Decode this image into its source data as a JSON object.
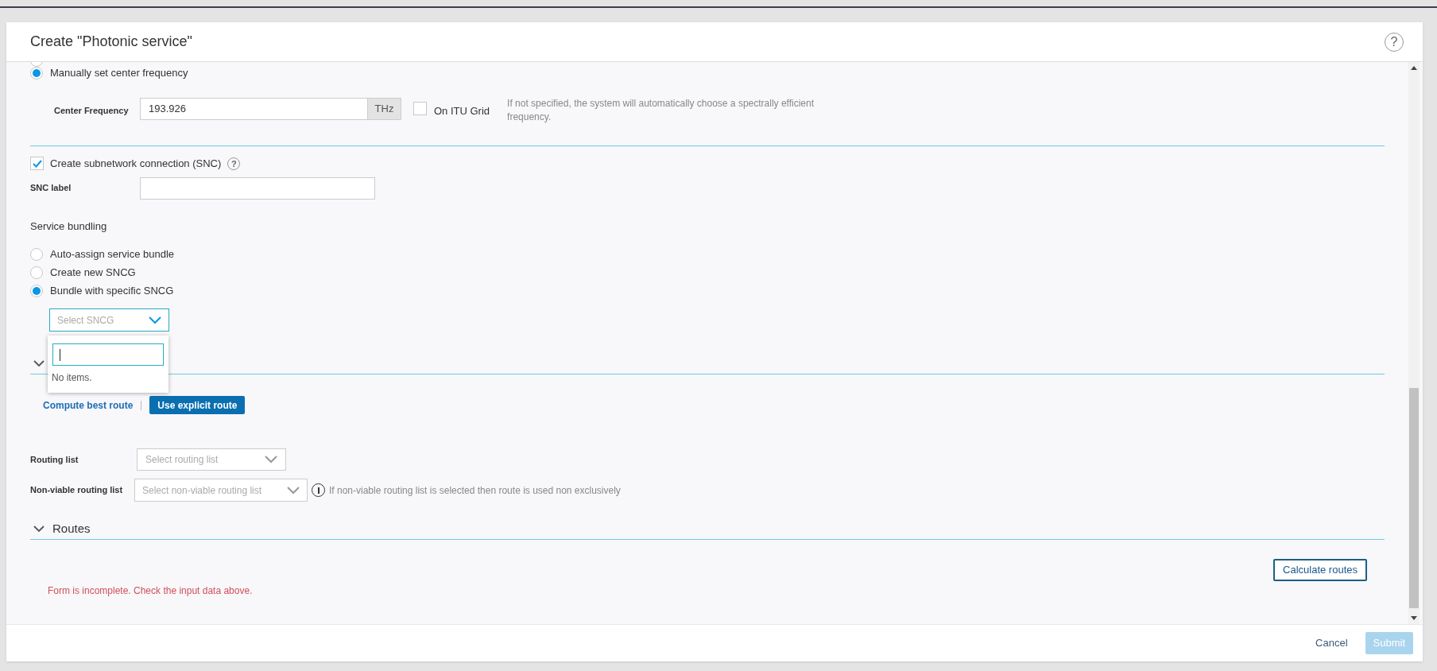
{
  "dialog": {
    "title": "Create \"Photonic service\"",
    "help": "?"
  },
  "frequency_mode": [
    {
      "selected": false
    },
    {
      "label": "Manually set center frequency",
      "selected": true
    }
  ],
  "center_frequency": {
    "label": "Center Frequency",
    "value": "193.926",
    "unit": "THz",
    "itu_grid": {
      "label": "On ITU Grid",
      "checked": false
    },
    "hint": "If not specified, the system will automatically choose a spectrally efficient frequency."
  },
  "snc": {
    "label": "Create subnetwork connection (SNC)",
    "checked": true,
    "help": "?"
  },
  "snc_label": {
    "label": "SNC label"
  },
  "service_bundling": {
    "title": "Service bundling",
    "options": [
      {
        "label": "Auto-assign service bundle",
        "selected": false
      },
      {
        "label": "Create new SNCG",
        "selected": false
      },
      {
        "label": "Bundle with specific SNCG",
        "selected": true
      }
    ],
    "sncg_select": {
      "placeholder": "Select SNCG",
      "open": true,
      "empty_text": "No items."
    }
  },
  "section_c": {
    "expanded": true
  },
  "route_mode": [
    {
      "label": "Compute best route",
      "selected": false
    },
    {
      "label": "Use explicit route",
      "selected": true
    }
  ],
  "routing_list": {
    "label": "Routing list",
    "placeholder": "Select routing list"
  },
  "non_viable_routing_list": {
    "label": "Non-viable routing list",
    "placeholder": "Select non-viable routing list",
    "info": "If non-viable routing list is selected then route is used non exclusively"
  },
  "routes": {
    "title": "Routes",
    "expanded": true,
    "calculate": "Calculate routes"
  },
  "error": "Form is incomplete. Check the input data above.",
  "footer": {
    "cancel": "Cancel",
    "submit": {
      "label": "Submit",
      "disabled": true
    }
  }
}
